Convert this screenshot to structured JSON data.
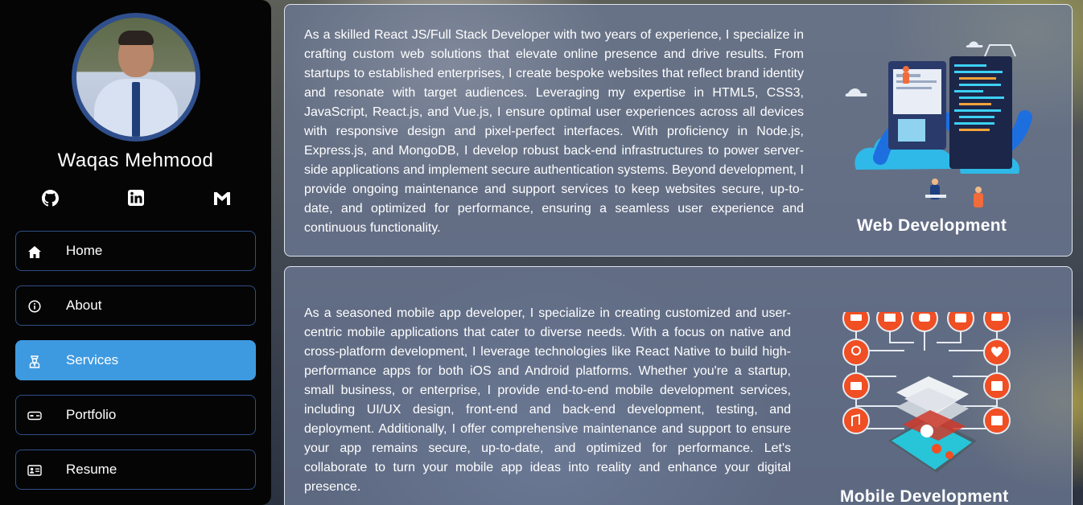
{
  "profile": {
    "name": "Waqas Mehmood"
  },
  "socials": [
    {
      "icon": "github-icon"
    },
    {
      "icon": "linkedin-icon"
    },
    {
      "icon": "gmail-icon"
    }
  ],
  "nav": {
    "items": [
      {
        "label": "Home",
        "icon": "home-icon",
        "active": false
      },
      {
        "label": "About",
        "icon": "info-icon",
        "active": false
      },
      {
        "label": "Services",
        "icon": "services-icon",
        "active": true
      },
      {
        "label": "Portfolio",
        "icon": "portfolio-icon",
        "active": false
      },
      {
        "label": "Resume",
        "icon": "resume-icon",
        "active": false
      }
    ]
  },
  "services": [
    {
      "title": "Web Development",
      "description": "As a skilled React JS/Full Stack Developer with two years of experience, I specialize in crafting custom web solutions that elevate online presence and drive results. From startups to established enterprises, I create bespoke websites that reflect brand identity and resonate with target audiences. Leveraging my expertise in HTML5, CSS3, JavaScript, React.js, and Vue.js, I ensure optimal user experiences across all devices with responsive design and pixel-perfect interfaces. With proficiency in Node.js, Express.js, and MongoDB, I develop robust back-end infrastructures to power server-side applications and implement secure authentication systems. Beyond development, I provide ongoing maintenance and support services to keep websites secure, up-to-date, and optimized for performance, ensuring a seamless user experience and continuous functionality.",
      "illustration": "web-development-illustration"
    },
    {
      "title": "Mobile Development",
      "description": "As a seasoned mobile app developer, I specialize in creating customized and user-centric mobile applications that cater to diverse needs. With a focus on native and cross-platform development, I leverage technologies like React Native to build high-performance apps for both iOS and Android platforms. Whether you're a startup, small business, or enterprise, I provide end-to-end mobile development services, including UI/UX design, front-end and back-end development, testing, and deployment. Additionally, I offer comprehensive maintenance and support to ensure your app remains secure, up-to-date, and optimized for performance. Let's collaborate to turn your mobile app ideas into reality and enhance your digital presence.",
      "illustration": "mobile-development-illustration"
    }
  ],
  "colors": {
    "sidebar_bg": "#050505",
    "nav_border": "#2e4f86",
    "nav_active": "#3e9ae0",
    "avatar_ring": "#2f4f8c",
    "card_bg": "rgba(108,120,148,0.78)",
    "accent_orange": "#f04e23"
  }
}
